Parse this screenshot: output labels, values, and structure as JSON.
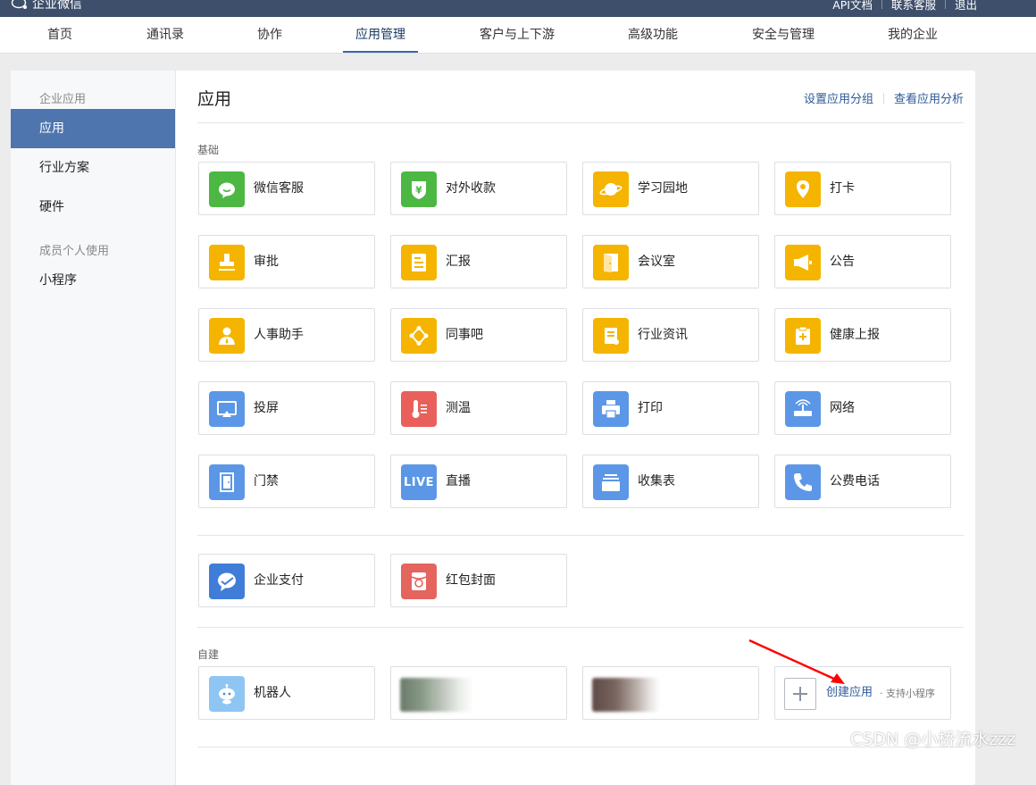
{
  "topbar": {
    "brand": "企业微信",
    "links": [
      "API文档",
      "联系客服",
      "退出"
    ]
  },
  "nav": {
    "items": [
      "首页",
      "通讯录",
      "协作",
      "应用管理",
      "客户与上下游",
      "高级功能",
      "安全与管理",
      "我的企业"
    ],
    "active": "应用管理"
  },
  "sidebar": {
    "heading1": "企业应用",
    "items1": [
      "应用",
      "行业方案",
      "硬件"
    ],
    "heading2": "成员个人使用",
    "items2": [
      "小程序"
    ]
  },
  "main": {
    "title": "应用",
    "links": [
      "设置应用分组",
      "查看应用分析"
    ],
    "section_basic": "基础",
    "basic_apps": [
      {
        "name": "微信客服",
        "icon": "wechat-service-icon"
      },
      {
        "name": "对外收款",
        "icon": "yuan-shield-icon"
      },
      {
        "name": "学习园地",
        "icon": "planet-icon"
      },
      {
        "name": "打卡",
        "icon": "location-pin-icon"
      },
      {
        "name": "审批",
        "icon": "stamp-icon"
      },
      {
        "name": "汇报",
        "icon": "report-icon"
      },
      {
        "name": "会议室",
        "icon": "door-icon"
      },
      {
        "name": "公告",
        "icon": "megaphone-icon"
      },
      {
        "name": "人事助手",
        "icon": "person-icon"
      },
      {
        "name": "同事吧",
        "icon": "network-icon"
      },
      {
        "name": "行业资讯",
        "icon": "news-scroll-icon"
      },
      {
        "name": "健康上报",
        "icon": "health-clipboard-icon"
      },
      {
        "name": "投屏",
        "icon": "screen-cast-icon"
      },
      {
        "name": "测温",
        "icon": "thermometer-icon"
      },
      {
        "name": "打印",
        "icon": "printer-icon"
      },
      {
        "name": "网络",
        "icon": "router-icon"
      },
      {
        "name": "门禁",
        "icon": "door-access-icon"
      },
      {
        "name": "直播",
        "icon": "live-icon"
      },
      {
        "name": "收集表",
        "icon": "collection-form-icon"
      },
      {
        "name": "公费电话",
        "icon": "phone-icon"
      }
    ],
    "live_text": "LIVE",
    "pay_apps": [
      {
        "name": "企业支付",
        "icon": "enterprise-pay-icon"
      },
      {
        "name": "红包封面",
        "icon": "red-packet-icon"
      }
    ],
    "section_custom": "自建",
    "custom_apps": [
      {
        "name": "机器人",
        "icon": "robot-icon"
      }
    ],
    "create_label": "创建应用",
    "create_sub": "· 支持小程序"
  },
  "watermark": "CSDN @小桥流水zzz",
  "colors": {
    "topbar": "#3d4f6a",
    "accent": "#4e75ad",
    "link": "#2e5a9a",
    "yellow_icon": "#f5b400",
    "green_icon": "#4cb843",
    "blue_icon": "#5b97e6",
    "red_icon": "#e9605b",
    "arrow": "#ff0000"
  }
}
